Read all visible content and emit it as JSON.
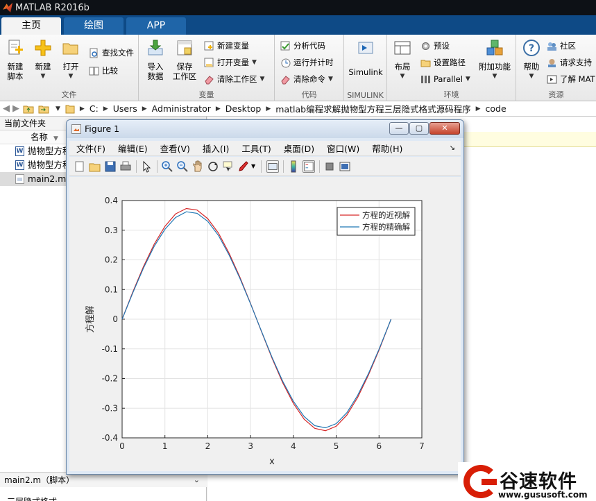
{
  "app": {
    "title": "MATLAB R2016b"
  },
  "tabs": [
    {
      "label": "主页",
      "active": true
    },
    {
      "label": "绘图",
      "active": false
    },
    {
      "label": "APP",
      "active": false
    }
  ],
  "ribbon": {
    "file": {
      "label": "文件",
      "new_script_line1": "新建",
      "new_script_line2": "脚本",
      "new_label": "新建",
      "open_label": "打开",
      "find_files": "查找文件",
      "compare": "比较"
    },
    "variable": {
      "label": "变量",
      "import_line1": "导入",
      "import_line2": "数据",
      "save_line1": "保存",
      "save_line2": "工作区",
      "new_variable": "新建变量",
      "open_variable": "打开变量",
      "clear_workspace": "清除工作区"
    },
    "code": {
      "label": "代码",
      "analyze": "分析代码",
      "run_time": "运行并计时",
      "clear_commands": "清除命令"
    },
    "simulink": {
      "label": "SIMULINK",
      "button": "Simulink"
    },
    "environment": {
      "label": "环境",
      "layout": "布局",
      "preferences": "预设",
      "set_path": "设置路径",
      "parallel": "Parallel",
      "addons": "附加功能"
    },
    "resources": {
      "label": "资源",
      "help": "帮助",
      "community": "社区",
      "request_support": "请求支持",
      "learn_matlab": "了解 MAT"
    }
  },
  "address": {
    "crumbs": [
      "C:",
      "Users",
      "Administrator",
      "Desktop",
      "matlab编程求解抛物型方程三层隐式格式源码程序",
      "code"
    ]
  },
  "current_folder": {
    "title": "当前文件夹",
    "name_header": "名称",
    "files": [
      {
        "name": "抛物型方程",
        "type": "word"
      },
      {
        "name": "抛物型方程",
        "type": "word"
      },
      {
        "name": "main2.m",
        "type": "m",
        "selected": true
      }
    ],
    "details_title": "main2.m（脚本）",
    "details_text": "三层隐式格式"
  },
  "figure": {
    "title": "Figure 1",
    "menu": [
      "文件(F)",
      "编辑(E)",
      "查看(V)",
      "插入(I)",
      "工具(T)",
      "桌面(D)",
      "窗口(W)",
      "帮助(H)"
    ]
  },
  "chart_data": {
    "type": "line",
    "xlabel": "x",
    "ylabel": "方程解",
    "xlim": [
      0,
      7
    ],
    "ylim": [
      -0.4,
      0.4
    ],
    "xticks": [
      0,
      1,
      2,
      3,
      4,
      5,
      6,
      7
    ],
    "yticks": [
      -0.4,
      -0.3,
      -0.2,
      -0.1,
      0,
      0.1,
      0.2,
      0.3,
      0.4
    ],
    "grid": true,
    "legend_position": "top-right",
    "series": [
      {
        "name": "方程的近视解",
        "color": "#d62728",
        "x": [
          0,
          0.25,
          0.5,
          0.75,
          1.0,
          1.25,
          1.5,
          1.75,
          2.0,
          2.25,
          2.5,
          2.75,
          3.0,
          3.25,
          3.5,
          3.75,
          4.0,
          4.25,
          4.5,
          4.75,
          5.0,
          5.25,
          5.5,
          5.75,
          6.0,
          6.28
        ],
        "y": [
          0,
          0.092,
          0.178,
          0.253,
          0.313,
          0.355,
          0.373,
          0.368,
          0.339,
          0.29,
          0.222,
          0.142,
          0.053,
          -0.04,
          -0.131,
          -0.214,
          -0.284,
          -0.337,
          -0.368,
          -0.376,
          -0.361,
          -0.323,
          -0.264,
          -0.189,
          -0.104,
          0
        ]
      },
      {
        "name": "方程的精确解",
        "color": "#1f77b4",
        "x": [
          0,
          0.25,
          0.5,
          0.75,
          1.0,
          1.25,
          1.5,
          1.75,
          2.0,
          2.25,
          2.5,
          2.75,
          3.0,
          3.25,
          3.5,
          3.75,
          4.0,
          4.25,
          4.5,
          4.75,
          5.0,
          5.25,
          5.5,
          5.75,
          6.0,
          6.28
        ],
        "y": [
          0,
          0.089,
          0.173,
          0.246,
          0.303,
          0.343,
          0.362,
          0.357,
          0.33,
          0.282,
          0.216,
          0.138,
          0.052,
          -0.039,
          -0.128,
          -0.209,
          -0.277,
          -0.328,
          -0.359,
          -0.366,
          -0.352,
          -0.315,
          -0.257,
          -0.184,
          -0.101,
          0
        ]
      }
    ]
  },
  "watermark": {
    "text": "谷速软件",
    "url": "www.gususoft.com",
    "color": "#d81e06"
  }
}
